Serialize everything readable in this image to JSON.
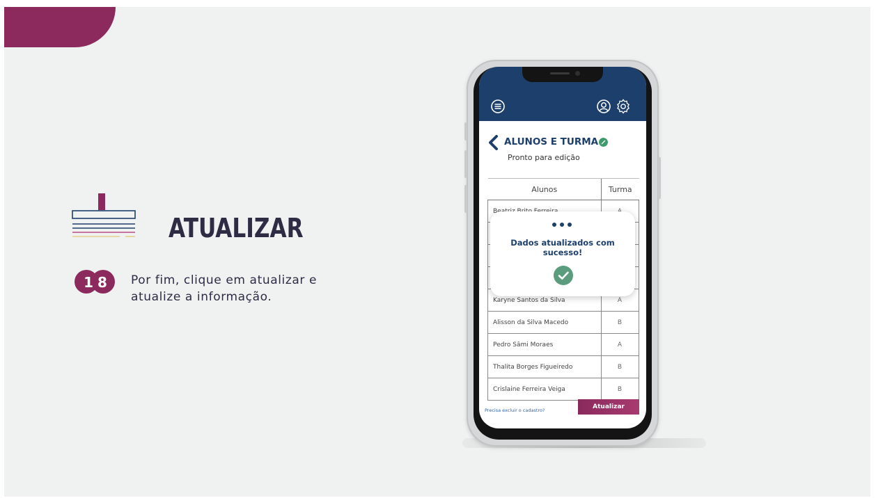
{
  "slide": {
    "title": "ATUALIZAR",
    "step_number": "18",
    "instruction": "Por fim, clique em atualizar e atualize a informação."
  },
  "app": {
    "header": {
      "icons": [
        "menu-icon",
        "user-icon",
        "settings-icon"
      ]
    },
    "page": {
      "title": "ALUNOS E TURMA",
      "subtitle": "Pronto para edição",
      "status_color": "#3d9a6a"
    },
    "table": {
      "columns": [
        "Alunos",
        "Turma"
      ],
      "rows": [
        {
          "name": "Beatriz Brito Ferreira",
          "turma": "A"
        },
        {
          "name": "",
          "turma": ""
        },
        {
          "name": "",
          "turma": ""
        },
        {
          "name": "",
          "turma": ""
        },
        {
          "name": "Karyne Santos da Silva",
          "turma": "A"
        },
        {
          "name": "Alisson da Silva Macedo",
          "turma": "B"
        },
        {
          "name": "Pedro Sâmi Moraes",
          "turma": "A"
        },
        {
          "name": "Thalita Borges Figueiredo",
          "turma": "B"
        },
        {
          "name": "Crislaine Ferreira Veiga",
          "turma": "B"
        }
      ]
    },
    "footer": {
      "link": "Precisa excluir o cadastro?",
      "update_button": "Atualizar"
    },
    "toast": {
      "message": "Dados atualizados com sucesso!",
      "icon": "check-icon"
    }
  },
  "colors": {
    "brand": "#8c2a5e",
    "app_header": "#1d3f6b",
    "success": "#5a9c7c"
  }
}
